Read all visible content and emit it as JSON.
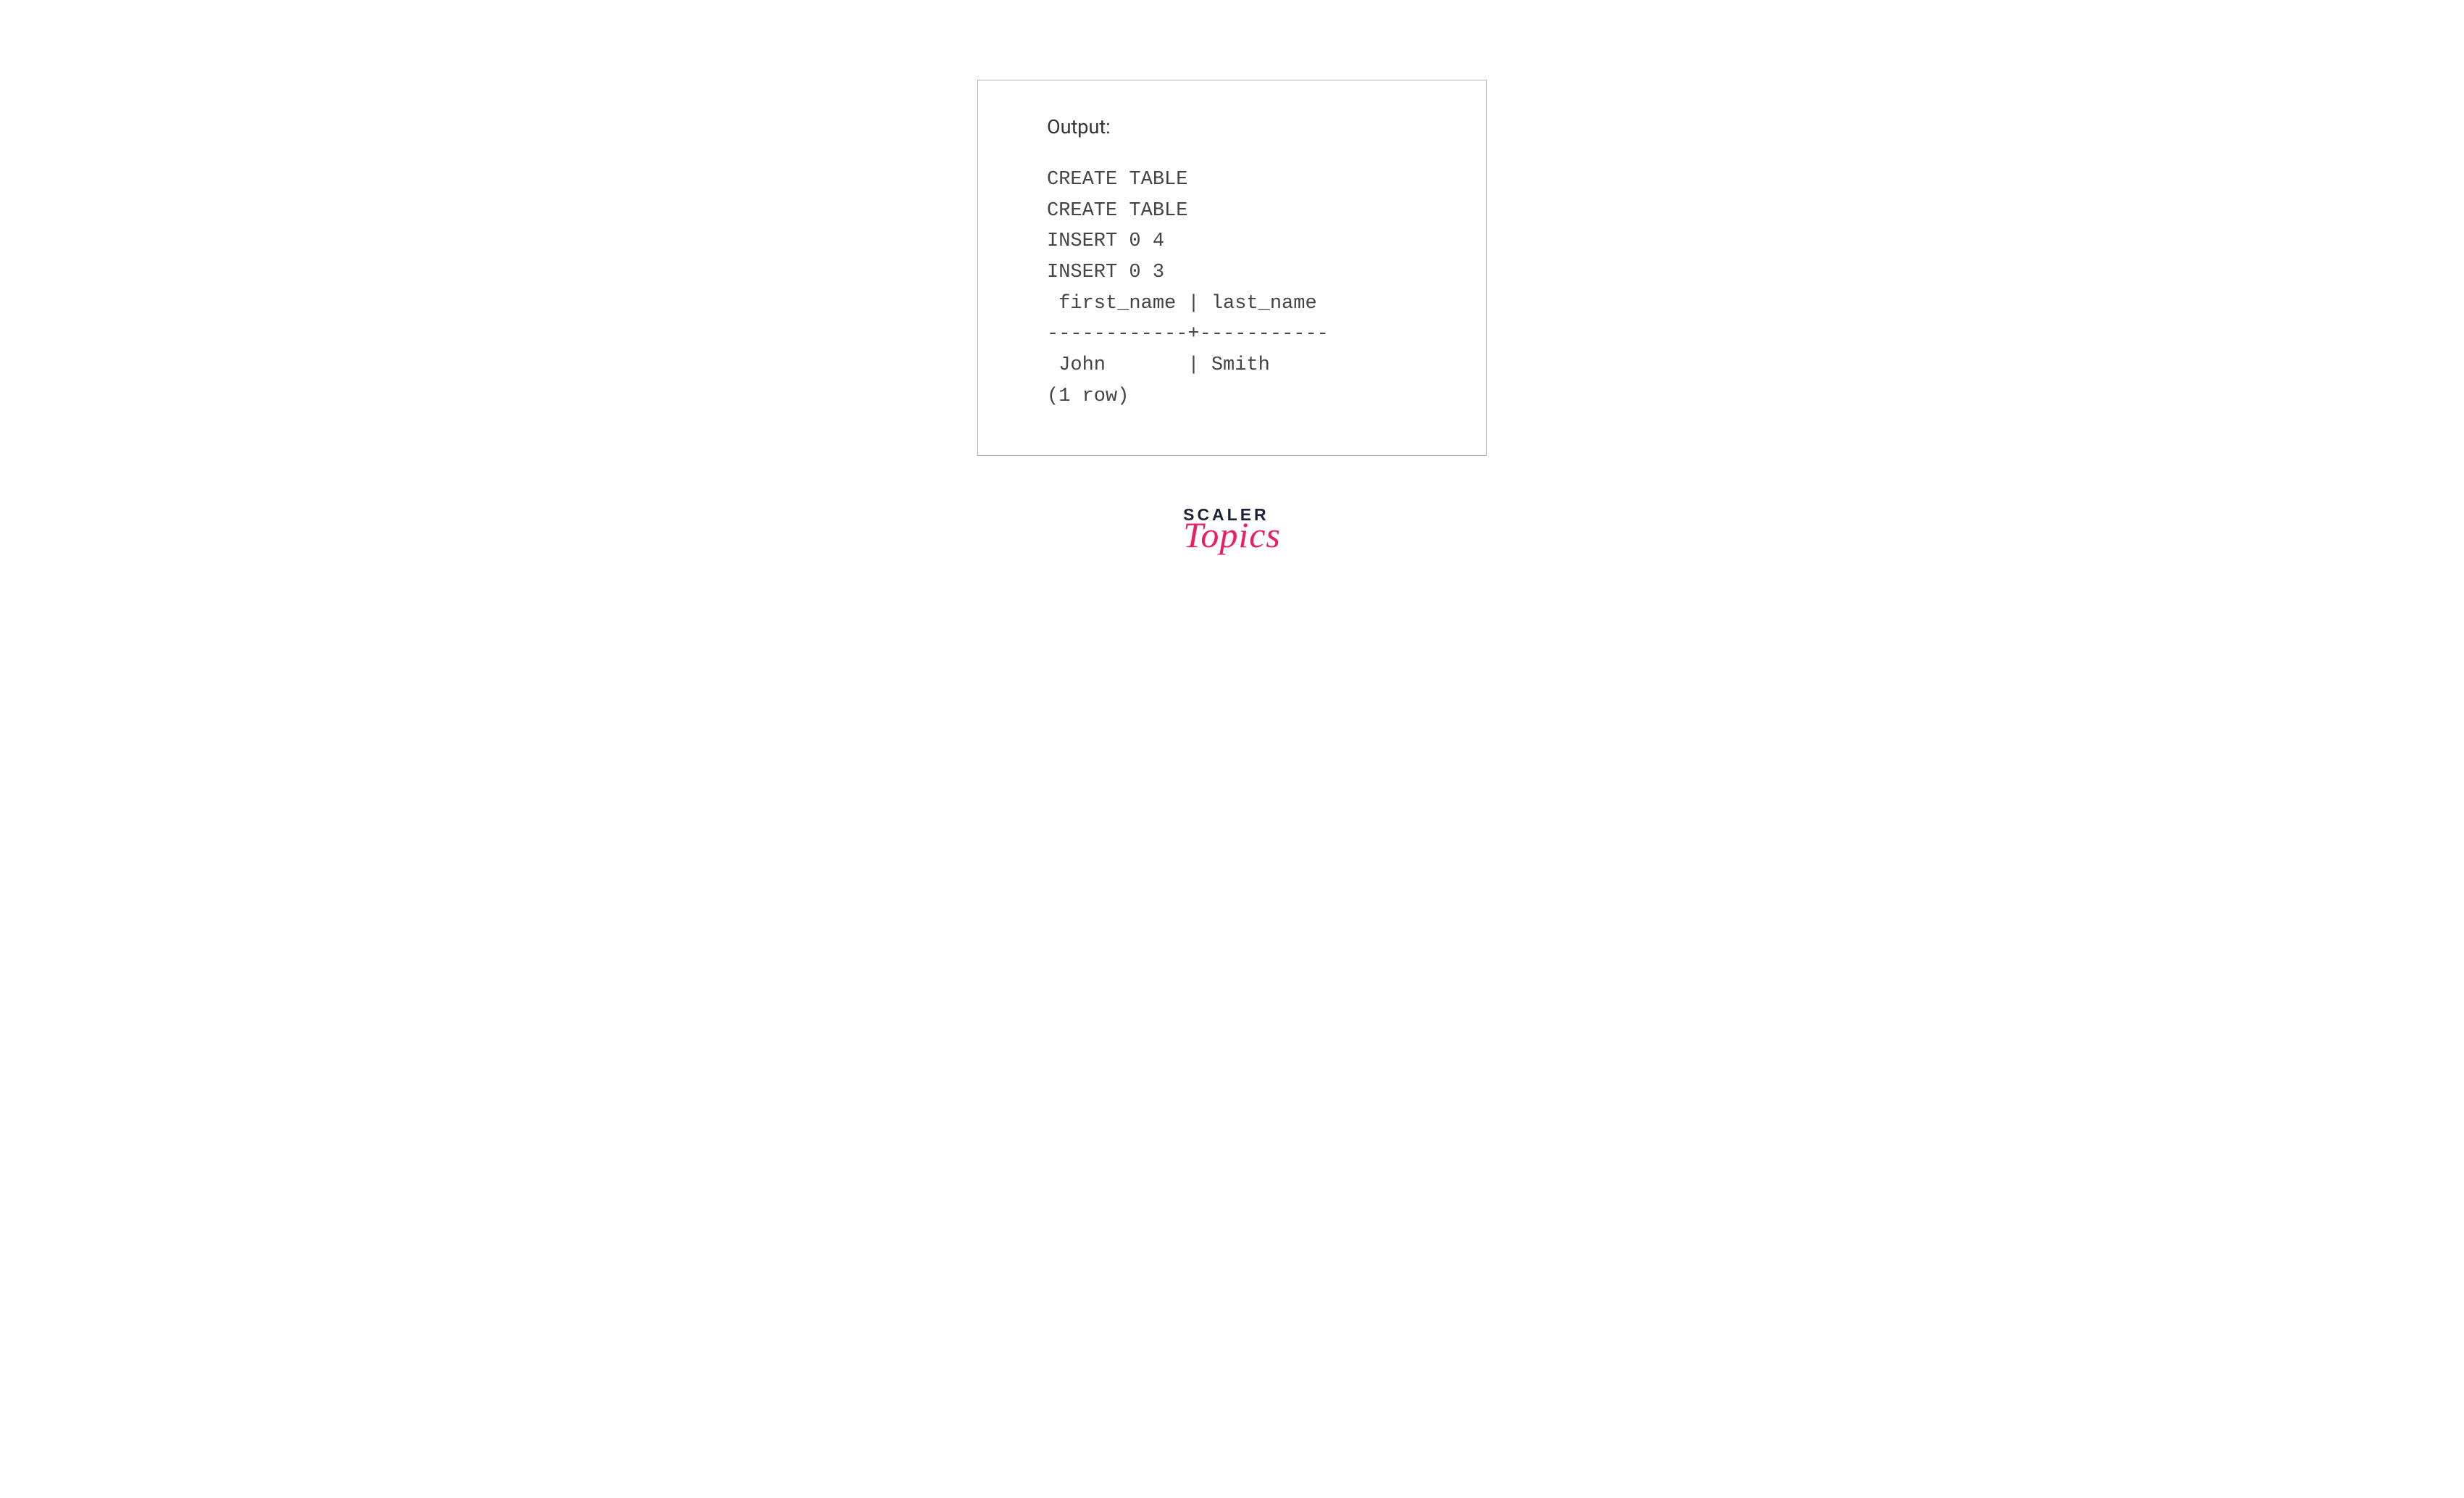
{
  "output": {
    "label": "Output:",
    "lines": [
      "CREATE TABLE",
      "CREATE TABLE",
      "INSERT 0 4",
      "INSERT 0 3",
      " first_name | last_name",
      "------------+-----------",
      " John       | Smith",
      "(1 row)"
    ]
  },
  "logo": {
    "line1": "SCALER",
    "line2": "Topics"
  }
}
